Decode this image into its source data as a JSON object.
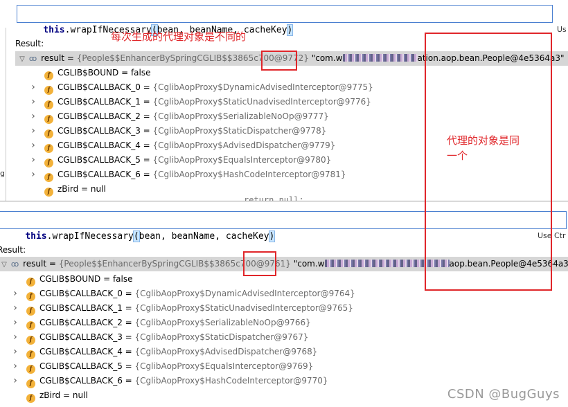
{
  "top": {
    "expression": {
      "kw": "this",
      "dot": ".",
      "name": "wrapIfNecessary",
      "open": "(",
      "args": "bean, beanName, cacheKey",
      "close": ")"
    },
    "use_label": "Us",
    "result_label": "Result:",
    "result_row": {
      "name": "result",
      "eq": " = ",
      "type_prefix": "{People$$EnhancerBySpringCGLIB$$3865c700",
      "id": "@9772}",
      "str_start": " \"com.w",
      "str_end": "ation.aop.bean.People@4e5364a3\""
    },
    "fields": [
      {
        "name": "CGLIB$BOUND",
        "value": "false",
        "grey": false,
        "expandable": false
      },
      {
        "name": "CGLIB$CALLBACK_0",
        "value": "{CglibAopProxy$DynamicAdvisedInterceptor@9775}",
        "grey": true,
        "expandable": true
      },
      {
        "name": "CGLIB$CALLBACK_1",
        "value": "{CglibAopProxy$StaticUnadvisedInterceptor@9776}",
        "grey": true,
        "expandable": true
      },
      {
        "name": "CGLIB$CALLBACK_2",
        "value": "{CglibAopProxy$SerializableNoOp@9777}",
        "grey": true,
        "expandable": true
      },
      {
        "name": "CGLIB$CALLBACK_3",
        "value": "{CglibAopProxy$StaticDispatcher@9778}",
        "grey": true,
        "expandable": true
      },
      {
        "name": "CGLIB$CALLBACK_4",
        "value": "{CglibAopProxy$AdvisedDispatcher@9779}",
        "grey": true,
        "expandable": true
      },
      {
        "name": "CGLIB$CALLBACK_5",
        "value": "{CglibAopProxy$EqualsInterceptor@9780}",
        "grey": true,
        "expandable": true
      },
      {
        "name": "CGLIB$CALLBACK_6",
        "value": "{CglibAopProxy$HashCodeInterceptor@9781}",
        "grey": true,
        "expandable": true
      },
      {
        "name": "zBird",
        "value": "null",
        "grey": false,
        "expandable": false
      }
    ]
  },
  "bottom": {
    "expression": {
      "kw": "this",
      "dot": ".",
      "name": "wrapIfNecessary",
      "open": "(",
      "args": "bean, beanName, cacheKey",
      "close": ")"
    },
    "use_label": "Use Ctr",
    "result_label": "Result:",
    "result_row": {
      "name": "result",
      "eq": " = ",
      "type_prefix": "{People$$EnhancerBySpringCGLIB$$3865c700",
      "id": "@9761}",
      "str_start": " \"com.w",
      "str_end": "aop.bean.People@4e5364a3\""
    },
    "fields": [
      {
        "name": "CGLIB$BOUND",
        "value": "false",
        "grey": false,
        "expandable": false
      },
      {
        "name": "CGLIB$CALLBACK_0",
        "value": "{CglibAopProxy$DynamicAdvisedInterceptor@9764}",
        "grey": true,
        "expandable": true
      },
      {
        "name": "CGLIB$CALLBACK_1",
        "value": "{CglibAopProxy$StaticUnadvisedInterceptor@9765}",
        "grey": true,
        "expandable": true
      },
      {
        "name": "CGLIB$CALLBACK_2",
        "value": "{CglibAopProxy$SerializableNoOp@9766}",
        "grey": true,
        "expandable": true
      },
      {
        "name": "CGLIB$CALLBACK_3",
        "value": "{CglibAopProxy$StaticDispatcher@9767}",
        "grey": true,
        "expandable": true
      },
      {
        "name": "CGLIB$CALLBACK_4",
        "value": "{CglibAopProxy$AdvisedDispatcher@9768}",
        "grey": true,
        "expandable": true
      },
      {
        "name": "CGLIB$CALLBACK_5",
        "value": "{CglibAopProxy$EqualsInterceptor@9769}",
        "grey": true,
        "expandable": true
      },
      {
        "name": "CGLIB$CALLBACK_6",
        "value": "{CglibAopProxy$HashCodeInterceptor@9770}",
        "grey": true,
        "expandable": true
      },
      {
        "name": "zBird",
        "value": "null",
        "grey": false,
        "expandable": false
      }
    ]
  },
  "annotations": {
    "top_note": "每次生成的代理对象是不同的",
    "right_note_line1": "代理的对象是同",
    "right_note_line2": "一个"
  },
  "background_code": "return null;",
  "left_edge_glyph": "g",
  "watermark": "CSDN @BugGuys",
  "colors": {
    "annotation_red": "#e0262a",
    "keyword_navy": "#000080",
    "grey_value": "#6a6a6a",
    "field_icon": "#f3b23a",
    "selected_row": "#d6d6d6",
    "expression_border": "#4a7fd0"
  }
}
